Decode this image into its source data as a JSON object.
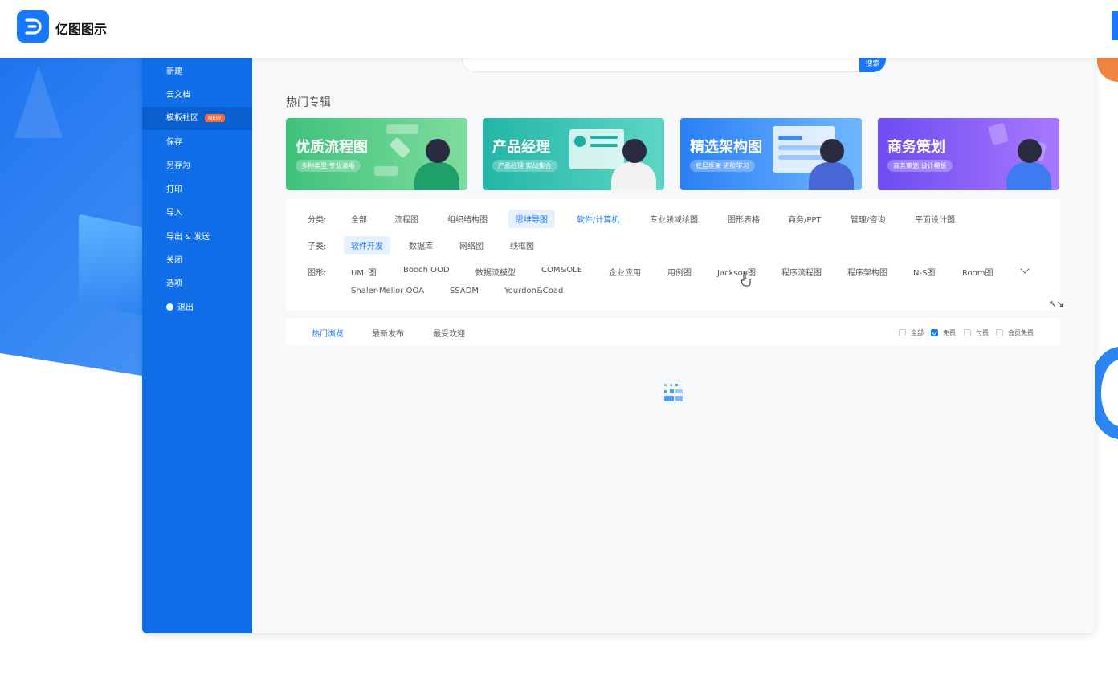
{
  "app": {
    "title": "亿图图示"
  },
  "sidebar": {
    "items": [
      {
        "label": "新建"
      },
      {
        "label": "云文档"
      },
      {
        "label": "模板社区",
        "badge": "NEW"
      },
      {
        "label": "保存"
      },
      {
        "label": "另存为"
      },
      {
        "label": "打印"
      },
      {
        "label": "导入"
      },
      {
        "label": "导出 & 发送"
      },
      {
        "label": "关闭"
      },
      {
        "label": "选项"
      },
      {
        "label": "退出"
      }
    ]
  },
  "search": {
    "button_label": "搜索"
  },
  "hot_section": {
    "title": "热门专辑",
    "banners": [
      {
        "title": "优质流程图",
        "subtitle": "多种类型 专业清晰"
      },
      {
        "title": "产品经理",
        "subtitle": "产品经理 实战集合"
      },
      {
        "title": "精选架构图",
        "subtitle": "底层框架 进阶学习"
      },
      {
        "title": "商务策划",
        "subtitle": "商务策划 设计模板"
      }
    ]
  },
  "filters": {
    "category_label": "分类:",
    "categories": [
      "全部",
      "流程图",
      "组织结构图",
      "思维导图",
      "软件/计算机",
      "专业领域绘图",
      "图形表格",
      "商务/PPT",
      "管理/咨询",
      "平面设计图"
    ],
    "selected_category": "思维导图",
    "hover_category": "软件/计算机",
    "subcategory_label": "子类:",
    "subcategories": [
      "软件开发",
      "数据库",
      "网络图",
      "线框图"
    ],
    "selected_subcategory": "软件开发",
    "shape_label": "图形:",
    "shapes": [
      "UML图",
      "Booch OOD",
      "数据流模型",
      "COM&OLE",
      "企业应用",
      "用例图",
      "Jackson图",
      "程序流程图",
      "程序架构图",
      "N-S图",
      "Room图",
      "Shaler-Mellor OOA",
      "SSADM",
      "Yourdon&Coad"
    ]
  },
  "sort_tabs": {
    "tabs": [
      "热门浏览",
      "最新发布",
      "最受欢迎"
    ],
    "active": "热门浏览",
    "price_filters": [
      {
        "label": "全部",
        "checked": false
      },
      {
        "label": "免费",
        "checked": true
      },
      {
        "label": "付费",
        "checked": false
      },
      {
        "label": "会员免费",
        "checked": false
      }
    ]
  },
  "colors": {
    "accent": "#1677ff",
    "sidebar": "#0f6ee8",
    "badge": "#ff6a3c"
  },
  "icons": [
    "logo-icon",
    "exit-icon",
    "chevron-down-icon",
    "expand-icon",
    "loading-icon",
    "pointer-cursor-icon"
  ]
}
